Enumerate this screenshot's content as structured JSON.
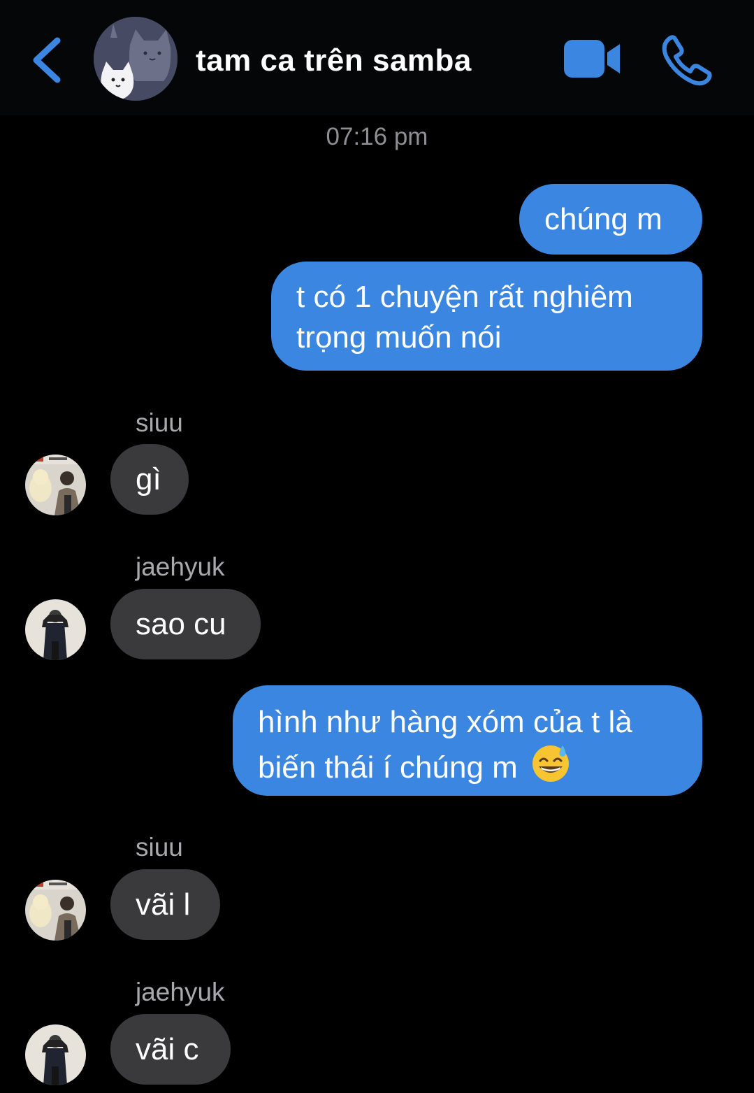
{
  "header": {
    "title": "tam ca trên samba",
    "back_icon": "chevron-left-icon",
    "video_icon": "video-camera-icon",
    "call_icon": "phone-icon",
    "accent_color": "#3a86e0"
  },
  "timestamp": "07:16 pm",
  "messages": [
    {
      "direction": "outgoing",
      "text": "chúng m"
    },
    {
      "direction": "outgoing",
      "text": "t có 1 chuyện rất nghiêm trọng muốn nói"
    },
    {
      "direction": "incoming",
      "sender": "siuu",
      "text": "gì"
    },
    {
      "direction": "incoming",
      "sender": "jaehyuk",
      "text": "sao cu"
    },
    {
      "direction": "outgoing",
      "text": "hình như hàng xóm của t là biến thái í chúng m",
      "emoji": "grinning-sweat-emoji"
    },
    {
      "direction": "incoming",
      "sender": "siuu",
      "text": "vãi l"
    },
    {
      "direction": "incoming",
      "sender": "jaehyuk",
      "text": "vãi c"
    }
  ],
  "colors": {
    "outgoing_bubble": "#3a86e0",
    "incoming_bubble": "#3a3a3c",
    "background": "#000000"
  }
}
